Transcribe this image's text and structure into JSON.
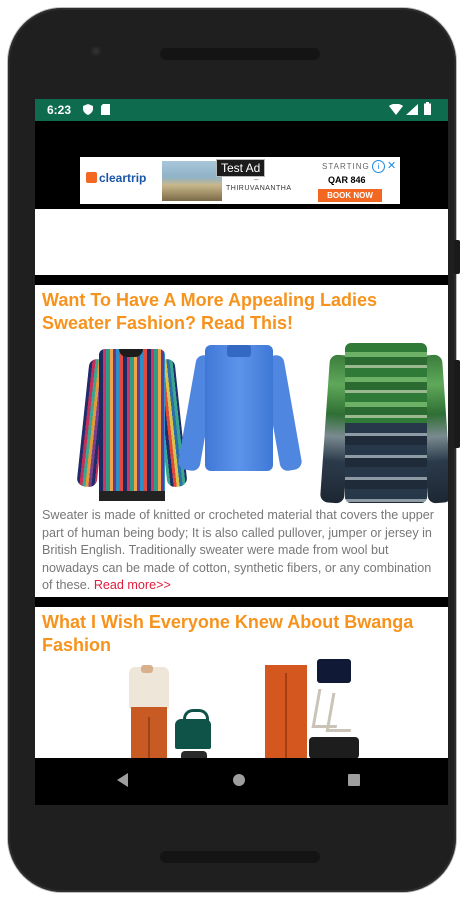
{
  "status_bar": {
    "time": "6:23",
    "icons": [
      "shield-icon",
      "sd-card-icon",
      "wifi-icon",
      "signal-icon",
      "battery-icon"
    ],
    "background": "#0f6b4e"
  },
  "ad": {
    "brand": "cleartrip",
    "test_label": "Test Ad",
    "route_from": "...",
    "route_dash": "–",
    "route_to": "THIRUVANANTHA",
    "starting_label": "STARTING",
    "price": "QAR 846",
    "cta": "BOOK NOW",
    "adchoices_label": "i",
    "close_label": "✕"
  },
  "articles": [
    {
      "title": "Want To Have A More Appealing Ladies Sweater Fashion? Read This!",
      "body": "Sweater is made of knitted or crocheted material that covers the upper part of human being body; It is also called pullover, jumper or jersey in British English. Traditionally sweater were made from wool but nowadays can be made of cotton, synthetic fibers, or any combination of these.",
      "read_more": "Read more>>"
    },
    {
      "title": "What I Wish Everyone Knew About Bwanga Fashion"
    }
  ],
  "colors": {
    "title_orange": "#f7931d",
    "read_more_red": "#e01c3c",
    "body_gray": "#777777"
  },
  "nav": {
    "back": "back-icon",
    "home": "home-icon",
    "recents": "recents-icon"
  }
}
